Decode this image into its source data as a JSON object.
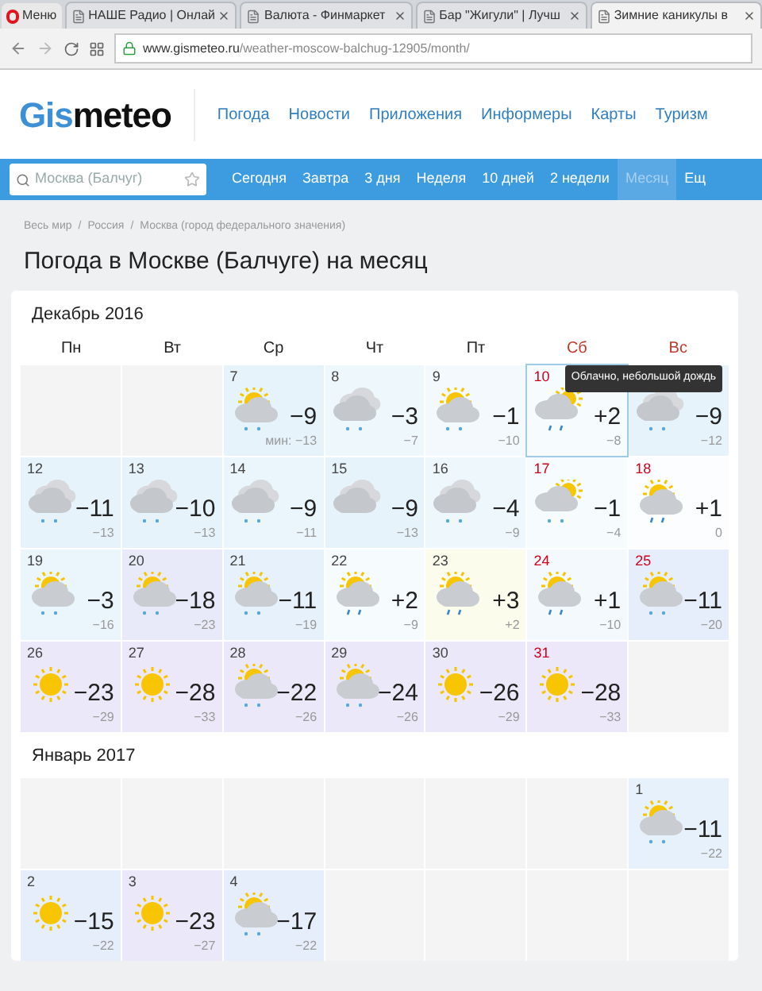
{
  "browser": {
    "menu_button": "Меню",
    "tabs": [
      {
        "title": "НАШЕ Радио | Онлай",
        "selected": false
      },
      {
        "title": "Валюта - Финмаркет",
        "selected": false
      },
      {
        "title": "Бар \"Жигули\" | Лучш",
        "selected": false
      },
      {
        "title": "Зимние каникулы в",
        "selected": true
      }
    ],
    "address_domain": "www.gismeteo.ru",
    "address_path": "/weather-moscow-balchug-12905/month/"
  },
  "logo": {
    "accent": "Gis",
    "rest": "meteo"
  },
  "main_nav": [
    "Погода",
    "Новости",
    "Приложения",
    "Информеры",
    "Карты",
    "Туризм"
  ],
  "search": {
    "placeholder": "Москва (Балчуг)"
  },
  "period_tabs": [
    {
      "label": "Сегодня",
      "selected": false
    },
    {
      "label": "Завтра",
      "selected": false
    },
    {
      "label": "3 дня",
      "selected": false
    },
    {
      "label": "Неделя",
      "selected": false
    },
    {
      "label": "10 дней",
      "selected": false
    },
    {
      "label": "2 недели",
      "selected": false
    },
    {
      "label": "Месяц",
      "selected": true
    },
    {
      "label": "Ещ",
      "selected": false
    }
  ],
  "breadcrumbs": [
    "Весь мир",
    "Россия",
    "Москва (город федерального значения)"
  ],
  "breadcrumb_separator": "/",
  "page_title": "Погода в Москве (Балчуге) на месяц",
  "weekdays": [
    {
      "label": "Пн",
      "weekend": false
    },
    {
      "label": "Вт",
      "weekend": false
    },
    {
      "label": "Ср",
      "weekend": false
    },
    {
      "label": "Чт",
      "weekend": false
    },
    {
      "label": "Пт",
      "weekend": false
    },
    {
      "label": "Сб",
      "weekend": true
    },
    {
      "label": "Вс",
      "weekend": true
    }
  ],
  "tooltip": "Облачно, небольшой дождь",
  "months": [
    {
      "title": "Декабрь 2016",
      "days": [
        {
          "kind": "empty"
        },
        {
          "kind": "empty"
        },
        {
          "kind": "day",
          "day": "7",
          "weekend": false,
          "highlighted": false,
          "color": "#e6f3fb",
          "icon": {
            "kind": "partly_snow"
          },
          "max": "−9",
          "min": "мин: −13"
        },
        {
          "kind": "day",
          "day": "8",
          "weekend": false,
          "highlighted": false,
          "color": "#eef7fc",
          "icon": {
            "kind": "cloudy_snow"
          },
          "max": "−3",
          "min": "−7"
        },
        {
          "kind": "day",
          "day": "9",
          "weekend": false,
          "highlighted": false,
          "color": "#f3f9fd",
          "icon": {
            "kind": "partly_snow"
          },
          "max": "−1",
          "min": "−10"
        },
        {
          "kind": "day",
          "day": "10",
          "weekend": true,
          "highlighted": true,
          "color": "#f6fbfd",
          "icon": {
            "kind": "cloud_sun_rain"
          },
          "max": "+2",
          "min": "−8"
        },
        {
          "kind": "day",
          "highlighted": false,
          "color": "#e6f3fb",
          "icon": {
            "kind": "cloudy_snow"
          },
          "max": "−9",
          "min": "−12"
        },
        {
          "kind": "day",
          "day": "12",
          "weekend": false,
          "highlighted": false,
          "color": "#e6f3fb",
          "icon": {
            "kind": "cloudy_snow"
          },
          "max": "−11",
          "min": "−13"
        },
        {
          "kind": "day",
          "day": "13",
          "weekend": false,
          "highlighted": false,
          "color": "#e6f3fb",
          "icon": {
            "kind": "cloudy_snow"
          },
          "max": "−10",
          "min": "−13"
        },
        {
          "kind": "day",
          "day": "14",
          "weekend": false,
          "highlighted": false,
          "color": "#eaf5fc",
          "icon": {
            "kind": "cloudy_snow"
          },
          "max": "−9",
          "min": "−11"
        },
        {
          "kind": "day",
          "day": "15",
          "weekend": false,
          "highlighted": false,
          "color": "#e6f3fb",
          "icon": {
            "kind": "cloudy"
          },
          "max": "−9",
          "min": "−13"
        },
        {
          "kind": "day",
          "day": "16",
          "weekend": false,
          "highlighted": false,
          "color": "#eef7fc",
          "icon": {
            "kind": "cloudy_snow"
          },
          "max": "−4",
          "min": "−9"
        },
        {
          "kind": "day",
          "day": "17",
          "weekend": true,
          "highlighted": false,
          "color": "#f6fbfd",
          "icon": {
            "kind": "cloud_sun_snow"
          },
          "max": "−1",
          "min": "−4"
        },
        {
          "kind": "day",
          "day": "18",
          "weekend": true,
          "highlighted": false,
          "color": "#fbfdfe",
          "icon": {
            "kind": "partly_rain"
          },
          "max": "+1",
          "min": "0"
        },
        {
          "kind": "day",
          "day": "19",
          "weekend": false,
          "highlighted": false,
          "color": "#eaf5fc",
          "icon": {
            "kind": "partly_snow"
          },
          "max": "−3",
          "min": "−16"
        },
        {
          "kind": "day",
          "day": "20",
          "weekend": false,
          "highlighted": false,
          "color": "#e9eaf9",
          "icon": {
            "kind": "partly_snow"
          },
          "max": "−18",
          "min": "−23"
        },
        {
          "kind": "day",
          "day": "21",
          "weekend": false,
          "highlighted": false,
          "color": "#e6f1fb",
          "icon": {
            "kind": "partly_snow"
          },
          "max": "−11",
          "min": "−19"
        },
        {
          "kind": "day",
          "day": "22",
          "weekend": false,
          "highlighted": false,
          "color": "#f6fbfd",
          "icon": {
            "kind": "partly_rain"
          },
          "max": "+2",
          "min": "−9"
        },
        {
          "kind": "day",
          "day": "23",
          "weekend": false,
          "highlighted": false,
          "color": "#fbfcec",
          "icon": {
            "kind": "partly_rain"
          },
          "max": "+3",
          "min": "+2"
        },
        {
          "kind": "day",
          "day": "24",
          "weekend": true,
          "highlighted": false,
          "color": "#f3f9fd",
          "icon": {
            "kind": "partly_rain"
          },
          "max": "+1",
          "min": "−10"
        },
        {
          "kind": "day",
          "day": "25",
          "weekend": true,
          "highlighted": false,
          "color": "#e6eefb",
          "icon": {
            "kind": "partly_snow"
          },
          "max": "−11",
          "min": "−20"
        },
        {
          "kind": "day",
          "day": "26",
          "weekend": false,
          "highlighted": false,
          "color": "#ebe9f9",
          "icon": {
            "kind": "sunny"
          },
          "max": "−23",
          "min": "−29"
        },
        {
          "kind": "day",
          "day": "27",
          "weekend": false,
          "highlighted": false,
          "color": "#ede8f9",
          "icon": {
            "kind": "sunny"
          },
          "max": "−28",
          "min": "−33"
        },
        {
          "kind": "day",
          "day": "28",
          "weekend": false,
          "highlighted": false,
          "color": "#ebe9f9",
          "icon": {
            "kind": "partly_snow"
          },
          "max": "−22",
          "min": "−26"
        },
        {
          "kind": "day",
          "day": "29",
          "weekend": false,
          "highlighted": false,
          "color": "#ebe9f9",
          "icon": {
            "kind": "partly_snow"
          },
          "max": "−24",
          "min": "−26"
        },
        {
          "kind": "day",
          "day": "30",
          "weekend": false,
          "highlighted": false,
          "color": "#ebe9f9",
          "icon": {
            "kind": "sunny"
          },
          "max": "−26",
          "min": "−29"
        },
        {
          "kind": "day",
          "day": "31",
          "weekend": true,
          "highlighted": false,
          "color": "#ede8f9",
          "icon": {
            "kind": "sunny"
          },
          "max": "−28",
          "min": "−33"
        },
        {
          "kind": "empty"
        }
      ]
    },
    {
      "title": "Январь 2017",
      "days": [
        {
          "kind": "empty"
        },
        {
          "kind": "empty"
        },
        {
          "kind": "empty"
        },
        {
          "kind": "empty"
        },
        {
          "kind": "empty"
        },
        {
          "kind": "empty"
        },
        {
          "kind": "day",
          "day": "1",
          "weekend": false,
          "highlighted": false,
          "color": "#e6f1fb",
          "icon": {
            "kind": "partly_snow"
          },
          "max": "−11",
          "min": "−22"
        },
        {
          "kind": "day",
          "day": "2",
          "weekend": false,
          "highlighted": false,
          "color": "#e6eefb",
          "icon": {
            "kind": "sunny"
          },
          "max": "−15",
          "min": "−22"
        },
        {
          "kind": "day",
          "day": "3",
          "weekend": false,
          "highlighted": false,
          "color": "#ebe9f9",
          "icon": {
            "kind": "sunny"
          },
          "max": "−23",
          "min": "−27"
        },
        {
          "kind": "day",
          "day": "4",
          "weekend": false,
          "highlighted": false,
          "color": "#e6eefb",
          "icon": {
            "kind": "partly_snow"
          },
          "max": "−17",
          "min": "−22"
        },
        {
          "kind": "empty"
        },
        {
          "kind": "empty"
        },
        {
          "kind": "empty"
        },
        {
          "kind": "empty"
        }
      ]
    }
  ]
}
